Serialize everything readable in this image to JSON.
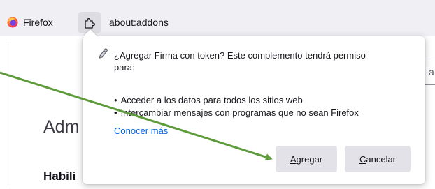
{
  "toolbar": {
    "identity_label": "Firefox",
    "identity_icon": "firefox-logo-icon",
    "extension_icon": "puzzle-piece-icon",
    "url": "about:addons"
  },
  "page": {
    "title_fragment": "Adm",
    "subtitle_fragment": "Habili",
    "search_fragment": "a"
  },
  "permission_panel": {
    "icon": "extension-icon",
    "heading_line1": "¿Agregar Firma con token? Este complemento tendrá permiso",
    "heading_line2": "para:",
    "permissions": [
      "Acceder a los datos para todos los sitios web",
      "Intercambiar mensajes con programas que no sean Firefox"
    ],
    "learn_more": "Conocer más",
    "add_button": {
      "accesskey": "A",
      "rest": "gregar"
    },
    "cancel_button": {
      "accesskey": "C",
      "rest": "ancelar"
    }
  },
  "annotation": {
    "icon": "arrow-annotation",
    "color": "#5e9b3b"
  },
  "colors": {
    "link": "#0061e0",
    "button_bg": "#e2e2e8",
    "toolbar_bg": "#f0f0f4"
  }
}
